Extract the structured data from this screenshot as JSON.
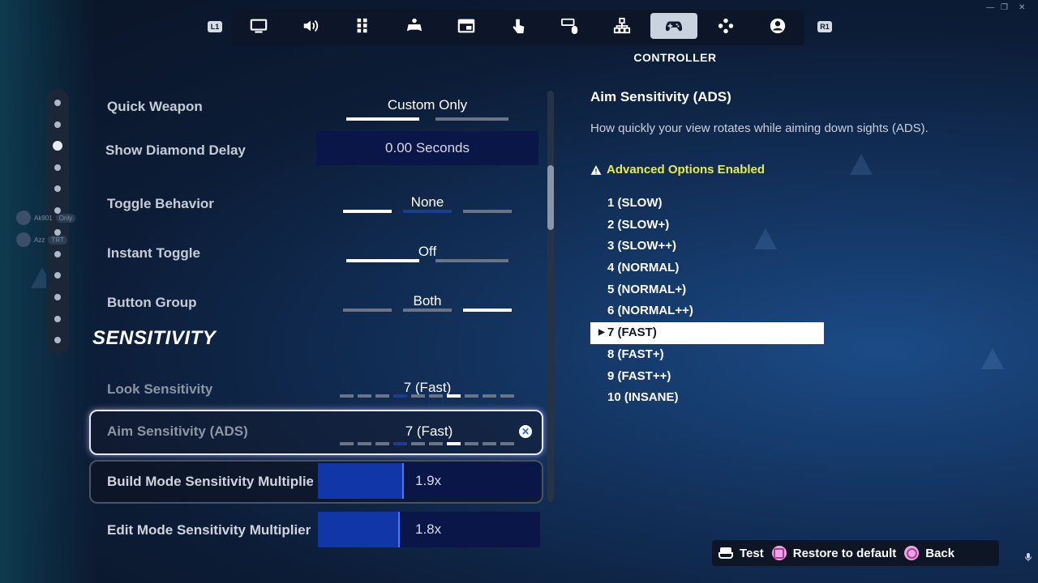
{
  "nav": {
    "l1": "L1",
    "r1": "R1",
    "tabs": [
      {
        "icon": "monitor-icon"
      },
      {
        "icon": "speaker-icon"
      },
      {
        "icon": "grid-icon"
      },
      {
        "icon": "gamepad-accessibility-icon"
      },
      {
        "icon": "window-icon"
      },
      {
        "icon": "touch-icon"
      },
      {
        "icon": "keyboard-mouse-icon"
      },
      {
        "icon": "network-icon"
      },
      {
        "icon": "controller-icon",
        "active": true
      },
      {
        "icon": "dpad-icon"
      },
      {
        "icon": "account-icon"
      }
    ],
    "active_caption": "CONTROLLER"
  },
  "ghost_players": [
    {
      "name": "Ak901",
      "tag": "Only"
    },
    {
      "name": "Azz",
      "tag": "TRT"
    }
  ],
  "settings": {
    "quick_weapon": {
      "label": "Quick Weapon",
      "value": "Custom Only"
    },
    "show_diamond_delay": {
      "label": "Show Diamond Delay",
      "value": "0.00 Seconds"
    },
    "toggle_behavior": {
      "label": "Toggle Behavior",
      "value": "None"
    },
    "instant_toggle": {
      "label": "Instant Toggle",
      "value": "Off"
    },
    "button_group": {
      "label": "Button Group",
      "value": "Both"
    },
    "section": "SENSITIVITY",
    "look_sensitivity": {
      "label": "Look Sensitivity",
      "value": "7 (Fast)",
      "level": 7,
      "max": 10
    },
    "aim_sensitivity": {
      "label": "Aim Sensitivity (ADS)",
      "value": "7 (Fast)",
      "level": 7,
      "max": 10
    },
    "build_mode": {
      "label": "Build Mode Sensitivity Multiplier",
      "value": "1.9x",
      "fill": 0.38
    },
    "edit_mode": {
      "label": "Edit Mode Sensitivity Multiplier",
      "value": "1.8x",
      "fill": 0.36
    }
  },
  "detail": {
    "title": "Aim Sensitivity (ADS)",
    "description": "How quickly your view rotates while aiming down sights (ADS).",
    "advanced": "Advanced Options Enabled",
    "options": [
      "1 (SLOW)",
      "2 (SLOW+)",
      "3 (SLOW++)",
      "4 (NORMAL)",
      "5 (NORMAL+)",
      "6 (NORMAL++)",
      "7 (FAST)",
      "8 (FAST+)",
      "9 (FAST++)",
      "10 (INSANE)"
    ],
    "selected_index": 6
  },
  "bottom": {
    "test": "Test",
    "restore": "Restore to default",
    "back": "Back"
  },
  "colors": {
    "accent_yellow": "#e8ec4a",
    "dark_blue_box": "#0a1648",
    "slider_fill": "#1036a8"
  }
}
